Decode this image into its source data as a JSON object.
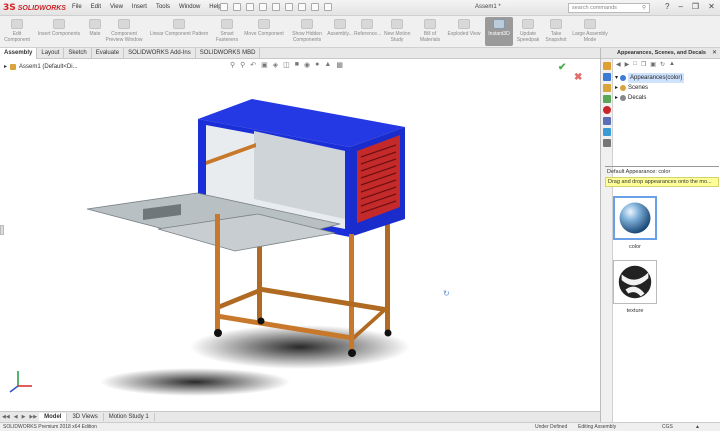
{
  "app": {
    "brand_mark": "3S",
    "brand_name": "SOLIDWORKS",
    "document_title": "Assem1 *"
  },
  "menu": [
    "File",
    "Edit",
    "View",
    "Insert",
    "Tools",
    "Window",
    "Help"
  ],
  "search": {
    "placeholder": "search commands",
    "icon": "search-icon"
  },
  "command_manager": [
    {
      "label": "Edit\nComponent"
    },
    {
      "label": "Insert Components"
    },
    {
      "label": "Mate"
    },
    {
      "label": "Component\nPreview Window"
    },
    {
      "label": "Linear Component Pattern"
    },
    {
      "label": "Smart\nFasteners"
    },
    {
      "label": "Move Component"
    },
    {
      "label": "Show Hidden\nComponents"
    },
    {
      "label": "Assembly..."
    },
    {
      "label": "Reference..."
    },
    {
      "label": "New Motion\nStudy"
    },
    {
      "label": "Bill of\nMaterials"
    },
    {
      "label": "Exploded View"
    },
    {
      "label": "Instant3D",
      "active": true
    },
    {
      "label": "Update\nSpeedpak"
    },
    {
      "label": "Take\nSnapshot"
    },
    {
      "label": "Large Assembly\nMode"
    }
  ],
  "tabs": [
    {
      "label": "Assembly",
      "active": true
    },
    {
      "label": "Layout"
    },
    {
      "label": "Sketch"
    },
    {
      "label": "Evaluate"
    },
    {
      "label": "SOLIDWORKS Add-Ins"
    },
    {
      "label": "SOLIDWORKS MBD"
    }
  ],
  "feature_tree": {
    "item": "Assem1  (Default<Di..."
  },
  "task_pane": {
    "title": "Appearances, Scenes, and Decals",
    "tree": [
      {
        "label": "Appearances(color)",
        "selected": true,
        "color": "#3a7bd5"
      },
      {
        "label": "Scenes",
        "color": "#d9a43a"
      },
      {
        "label": "Decals",
        "color": "#888888"
      }
    ],
    "hint_title": "Default Appearance: color",
    "hint_text": "Drag and drop appearances onto the mo...",
    "thumbnails": [
      {
        "label": "color",
        "selected": true
      },
      {
        "label": "texture"
      }
    ]
  },
  "model_tabs": [
    {
      "label": "Model",
      "active": true
    },
    {
      "label": "3D Views"
    },
    {
      "label": "Motion Study 1"
    }
  ],
  "status": {
    "left": "SOLIDWORKS Premium 2018 x64 Edition",
    "under_defined": "Under Defined",
    "editing": "Editing Assembly",
    "units": "CGS"
  },
  "colors": {
    "cabinet_blue": "#1a2fd8",
    "door_red": "#c42a2a",
    "leg_orange": "#c8782a",
    "tray_grey": "#b8c0c4"
  }
}
